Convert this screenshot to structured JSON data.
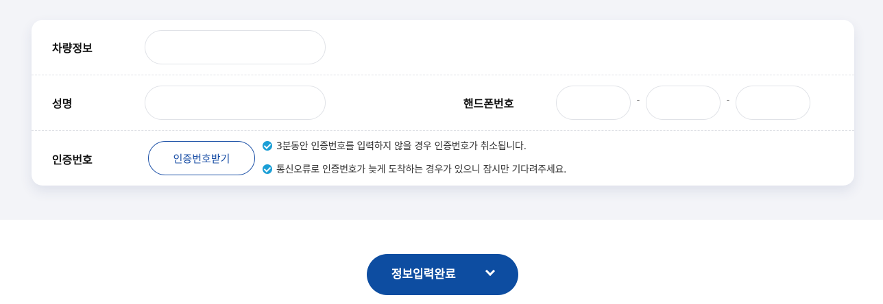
{
  "form": {
    "vehicle": {
      "label": "차량정보",
      "value": "",
      "placeholder": ""
    },
    "name": {
      "label": "성명",
      "value": "",
      "placeholder": ""
    },
    "phone": {
      "label": "핸드폰번호",
      "parts": [
        "",
        "",
        ""
      ],
      "separator": "-"
    },
    "verification": {
      "label": "인증번호",
      "button_label": "인증번호받기",
      "notices": [
        "3분동안 인증번호를 입력하지 않을 경우 인증번호가 취소됩니다.",
        "통신오류로 인증번호가 늦게 도착하는 경우가 있으니 잠시만 기다려주세요."
      ]
    }
  },
  "submit": {
    "label": "정보입력완료",
    "icon": "chevron-down-icon"
  },
  "colors": {
    "primary": "#0d4da1",
    "check": "#1b9fd6",
    "band": "#f3f4f8"
  }
}
